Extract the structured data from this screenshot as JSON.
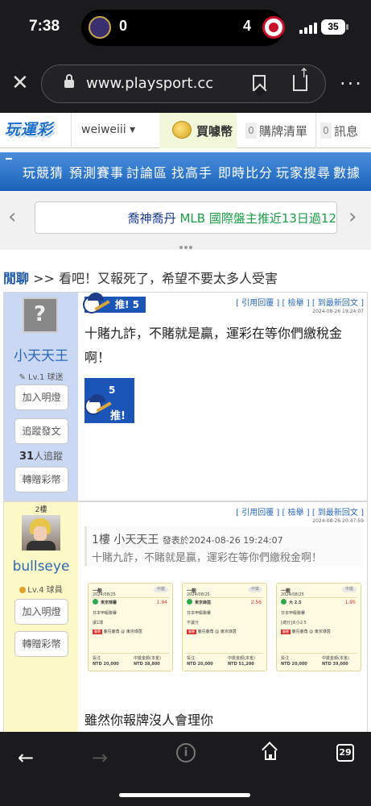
{
  "status_bar": {
    "time": "7:38",
    "left_score": "0",
    "right_score": "4",
    "battery": "35"
  },
  "browser": {
    "url": "www.playsport.cc",
    "close_icon": "close-icon",
    "tab_count": "29"
  },
  "site_header": {
    "logo_text": "玩運彩",
    "username": "weiweiii ▾",
    "buy_label": "買噱幣",
    "cart_count": "0",
    "cart_label": "購牌清單",
    "msg_count": "0",
    "msg_label": "訊息"
  },
  "menu": [
    "玩競猜",
    "預測賽事",
    "討論區",
    "找高手",
    "即時比分",
    "玩家搜尋",
    "數據"
  ],
  "banner": {
    "text_a": "喬神喬丹",
    "text_b": " MLB 國際盤主推近13日過12"
  },
  "thread": {
    "category": "閒聊",
    "sep": " >> ",
    "title": "看吧！又報死了，希望不要太多人受害"
  },
  "post1": {
    "username": "小天天王",
    "level": "✎ Lv.1 球迷",
    "btn_lamp": "加入明燈",
    "btn_follow": "追蹤發文",
    "follow_count": "31",
    "follow_label": "人追蹤",
    "btn_gift": "轉贈彩幣",
    "badge": "推! 5",
    "actions": "[ 引用回覆 ]  [ 檢舉 ]  [ 到最新回文 ]",
    "timestamp": "2024-08-26 19:24:07",
    "content": "十賭九詐，不賭就是贏，運彩在等你們繳稅金啊！",
    "push_count": "5",
    "push_label": "推!"
  },
  "post2": {
    "floor": "2樓",
    "username": "bullseye",
    "level": "Lv.4 球員",
    "btn_lamp": "加入明燈",
    "btn_gift": "轉贈彩幣",
    "actions": "[ 引用回覆 ]  [ 檢舉 ]  [ 到最新回文 ]",
    "timestamp": "2024-08-26 20:47:59",
    "quote_head": "1樓  小天天王 ",
    "quote_time": "發表於2024-08-26 19:24:07",
    "quote_text": "十賭九詐，不賭就是贏，運彩在等你們繳稅金啊！",
    "tickets": [
      {
        "type": "一般",
        "date": "2024/08/25",
        "status": "中獎",
        "pick": "東京辣蕾",
        "odds": "1.94",
        "league": "日本甲級聯賽",
        "bet": "讓1球",
        "match": "鹿島鹿角 @ 東京綠茵",
        "stake": "NTD 20,000",
        "payout": "NTD 38,800"
      },
      {
        "type": "一般",
        "date": "2024/08/25",
        "status": "中獎",
        "pick": "東京綠茵",
        "odds": "2.56",
        "league": "日本甲級聯賽",
        "bet": "不讓分",
        "match": "鹿島鹿角 @ 東京綠茵",
        "stake": "NTD 20,000",
        "payout": "NTD 51,200"
      },
      {
        "type": "一般",
        "date": "2024/08/25",
        "status": "中獎",
        "pick": "大 2.5",
        "odds": "1.95",
        "league": "日本甲級聯賽",
        "bet": "[總分]大小2.5",
        "match": "鹿島鹿角 @ 東京綠茵",
        "stake": "NTD 20,000",
        "payout": "NTD 39,000"
      }
    ],
    "stake_label": "投注",
    "payout_label": "中獎金額(本金)",
    "content": "雖然你報牌沒人會理你"
  },
  "bottom_bar": {
    "back_icon": "back-arrow-icon",
    "forward_icon": "forward-arrow-icon",
    "info_icon": "info-icon",
    "home_icon": "home-icon",
    "tabs_icon": "tabs-icon"
  }
}
